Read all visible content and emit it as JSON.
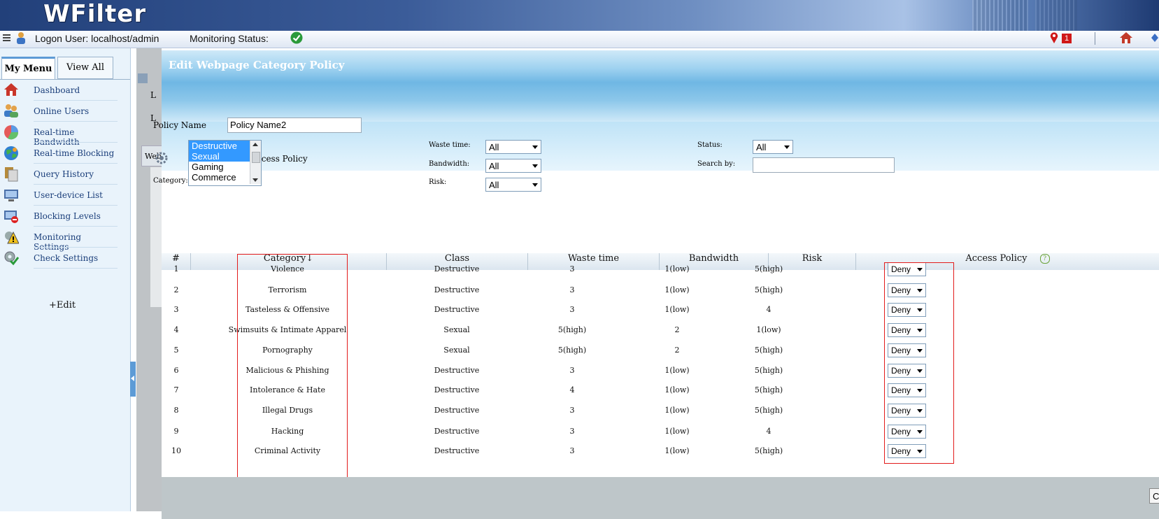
{
  "app": {
    "logo": "WFilter",
    "alert_count": "1"
  },
  "status": {
    "logon": "Logon User: localhost/admin",
    "monitoring": "Monitoring Status:"
  },
  "sidebar": {
    "tabs": [
      "My Menu",
      "View All"
    ],
    "items": [
      {
        "label": "Dashboard",
        "icon": "home-icon"
      },
      {
        "label": "Online Users",
        "icon": "users-icon"
      },
      {
        "label": "Real-time Bandwidth",
        "icon": "pie-chart-icon"
      },
      {
        "label": "Real-time Blocking",
        "icon": "globe-icon"
      },
      {
        "label": "Query History",
        "icon": "documents-icon"
      },
      {
        "label": "User-device List",
        "icon": "monitor-icon"
      },
      {
        "label": "Blocking Levels",
        "icon": "blocking-icon"
      },
      {
        "label": "Monitoring Settings",
        "icon": "warning-gear-icon"
      },
      {
        "label": "Check Settings",
        "icon": "gear-check-icon"
      }
    ],
    "edit": "+Edit"
  },
  "dialog": {
    "title": "Edit Webpage Category Policy",
    "section": "Add Category Access Policy",
    "policy_name_label": "Policy Name",
    "policy_name_value": "Policy Name2",
    "category_label": "Category:",
    "category_options": [
      "Destructive",
      "Sexual",
      "Gaming",
      "Commerce"
    ],
    "category_selected": [
      "Destructive",
      "Sexual"
    ],
    "filters": {
      "waste_time_label": "Waste time:",
      "waste_time_value": "All",
      "bandwidth_label": "Bandwidth:",
      "bandwidth_value": "All",
      "risk_label": "Risk:",
      "risk_value": "All",
      "status_label": "Status:",
      "status_value": "All",
      "search_label": "Search by:",
      "search_value": ""
    }
  },
  "table": {
    "headers": [
      "#",
      "Category↓",
      "Class",
      "Waste time",
      "Bandwidth",
      "Risk",
      "Access Policy"
    ],
    "rows": [
      {
        "n": "1",
        "cat": "Violence",
        "cls": "Destructive",
        "waste": "3",
        "bw": "1(low)",
        "risk": "5(high)",
        "policy": "Deny"
      },
      {
        "n": "2",
        "cat": "Terrorism",
        "cls": "Destructive",
        "waste": "3",
        "bw": "1(low)",
        "risk": "5(high)",
        "policy": "Deny"
      },
      {
        "n": "3",
        "cat": "Tasteless & Offensive",
        "cls": "Destructive",
        "waste": "3",
        "bw": "1(low)",
        "risk": "4",
        "policy": "Deny"
      },
      {
        "n": "4",
        "cat": "Swimsuits & Intimate Apparel",
        "cls": "Sexual",
        "waste": "5(high)",
        "bw": "2",
        "risk": "1(low)",
        "policy": "Deny"
      },
      {
        "n": "5",
        "cat": "Pornography",
        "cls": "Sexual",
        "waste": "5(high)",
        "bw": "2",
        "risk": "5(high)",
        "policy": "Deny"
      },
      {
        "n": "6",
        "cat": "Malicious & Phishing",
        "cls": "Destructive",
        "waste": "3",
        "bw": "1(low)",
        "risk": "5(high)",
        "policy": "Deny"
      },
      {
        "n": "7",
        "cat": "Intolerance & Hate",
        "cls": "Destructive",
        "waste": "4",
        "bw": "1(low)",
        "risk": "5(high)",
        "policy": "Deny"
      },
      {
        "n": "8",
        "cat": "Illegal Drugs",
        "cls": "Destructive",
        "waste": "3",
        "bw": "1(low)",
        "risk": "5(high)",
        "policy": "Deny"
      },
      {
        "n": "9",
        "cat": "Hacking",
        "cls": "Destructive",
        "waste": "3",
        "bw": "1(low)",
        "risk": "4",
        "policy": "Deny"
      },
      {
        "n": "10",
        "cat": "Criminal Activity",
        "cls": "Destructive",
        "waste": "3",
        "bw": "1(low)",
        "risk": "5(high)",
        "policy": "Deny"
      }
    ]
  },
  "underlay": {
    "tab_partial": "Web",
    "letter": "L",
    "footer_btn": "C"
  }
}
